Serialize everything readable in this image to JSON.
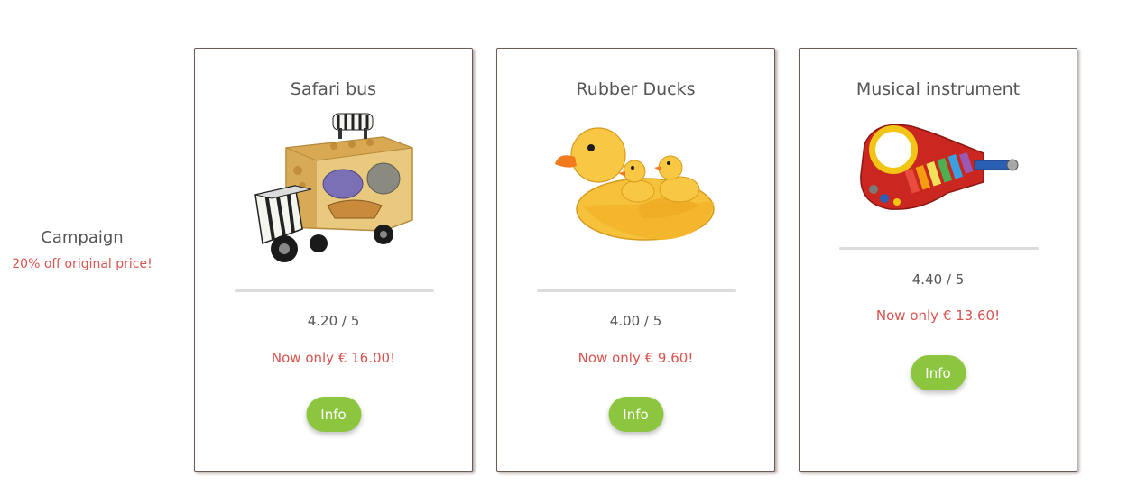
{
  "campaign": {
    "title": "Campaign",
    "subtitle": "20% off original price!"
  },
  "products": [
    {
      "title": "Safari bus",
      "image": "safari-bus-toy",
      "rating": "4.20 / 5",
      "price": "Now only € 16.00!",
      "button_label": "Info"
    },
    {
      "title": "Rubber Ducks",
      "image": "rubber-ducks",
      "rating": "4.00 / 5",
      "price": "Now only € 9.60!",
      "button_label": "Info"
    },
    {
      "title": "Musical instrument",
      "image": "toy-guitar",
      "rating": "4.40 / 5",
      "price": "Now only € 13.60!",
      "button_label": "Info"
    }
  ],
  "colors": {
    "price_red": "#d9534f",
    "button_green": "#8cc63f",
    "text_gray": "#555555"
  }
}
